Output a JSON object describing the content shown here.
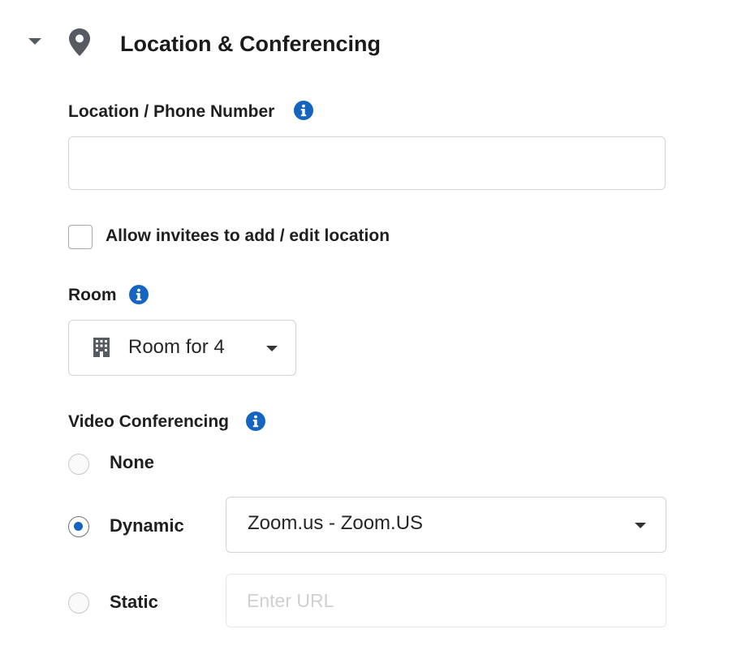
{
  "section": {
    "title": "Location & Conferencing",
    "icons": {
      "collapse": "caret-down-icon",
      "section": "map-pin-icon"
    }
  },
  "location": {
    "label": "Location / Phone Number",
    "info_icon": "info-icon",
    "value": "",
    "placeholder": ""
  },
  "allow_edit": {
    "label": "Allow invitees to add / edit location",
    "checked": false
  },
  "room": {
    "label": "Room",
    "info_icon": "info-icon",
    "selected": "Room for 4",
    "icon": "building-icon"
  },
  "video": {
    "label": "Video Conferencing",
    "info_icon": "info-icon",
    "options": [
      {
        "label": "None",
        "checked": false
      },
      {
        "label": "Dynamic",
        "checked": true
      },
      {
        "label": "Static",
        "checked": false
      }
    ],
    "dynamic_provider": "Zoom.us - Zoom.US",
    "static_url_placeholder": "Enter URL",
    "static_url_value": ""
  },
  "colors": {
    "accent": "#1565c0",
    "text": "#1f1f1f",
    "icon_gray": "#555b61",
    "border": "#d4d4d4"
  }
}
